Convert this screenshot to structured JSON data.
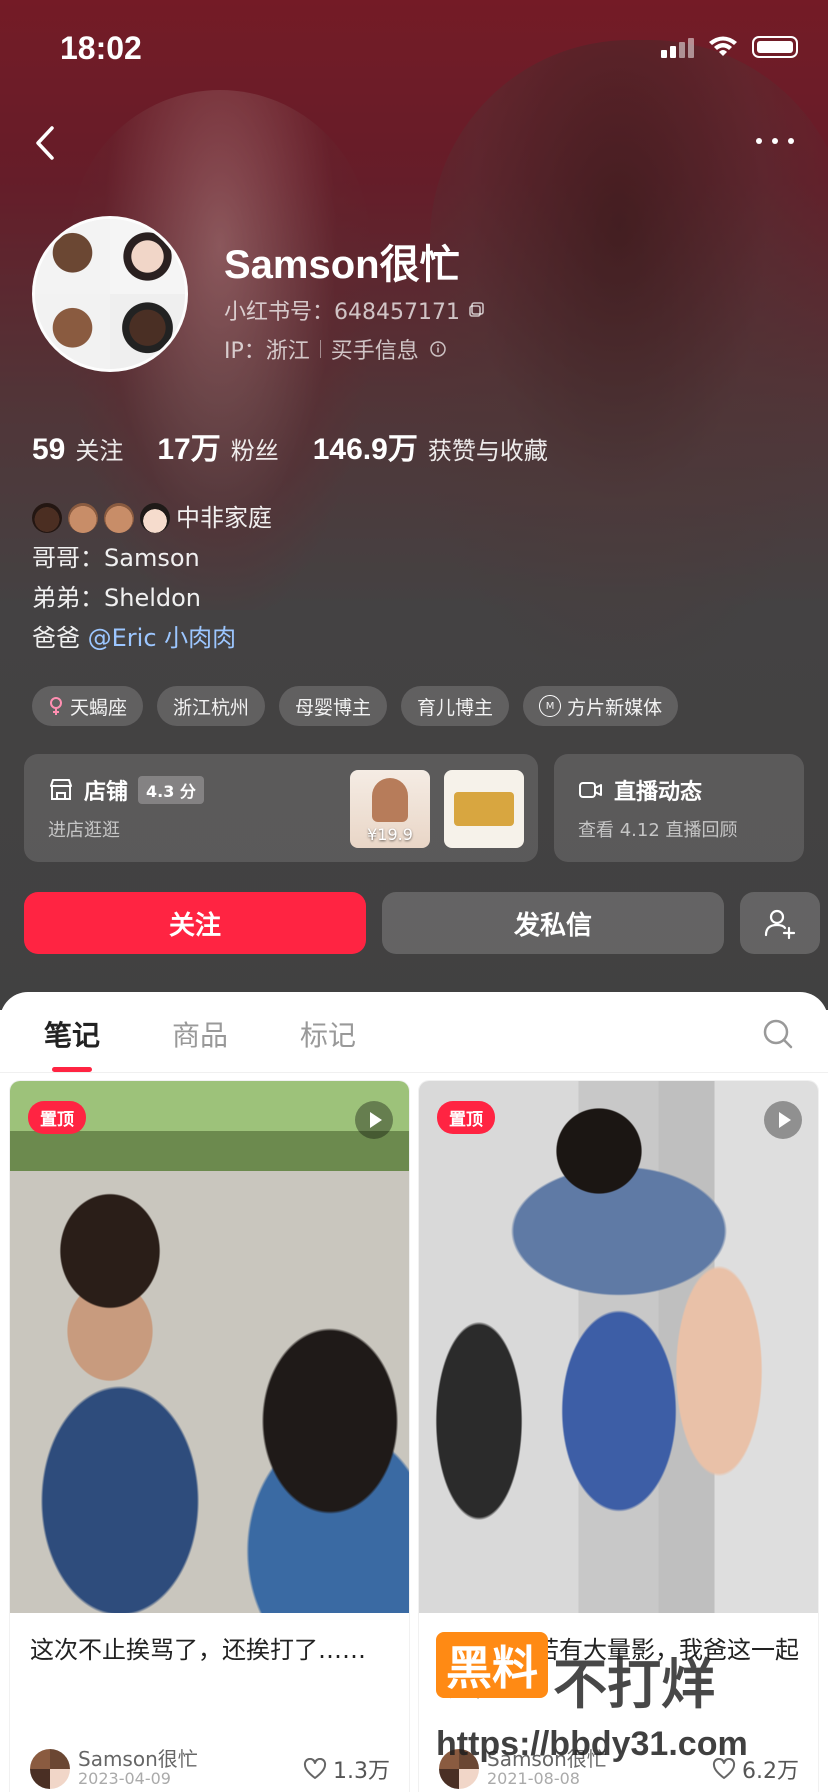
{
  "status": {
    "time": "18:02"
  },
  "profile": {
    "name": "Samson很忙",
    "id_line": "小红书号：648457171",
    "ip_label": "IP：浙江",
    "buyer_info": "买手信息",
    "stats": [
      {
        "num": "59",
        "label": "关注"
      },
      {
        "num": "17万",
        "label": "粉丝"
      },
      {
        "num": "146.9万",
        "label": "获赞与收藏"
      }
    ],
    "bio": {
      "family": "中非家庭",
      "line_brother": "哥哥：Samson",
      "line_younger": "弟弟：Sheldon",
      "line_dad_prefix": "爸爸",
      "line_dad_link": "@Eric 小肉肉"
    },
    "tags": [
      "天蝎座",
      "浙江杭州",
      "母婴博主",
      "育儿博主",
      "方片新媒体"
    ],
    "shop": {
      "title": "店铺",
      "rating": "4.3 分",
      "sub": "进店逛逛",
      "price1": "¥19.9"
    },
    "live": {
      "title": "直播动态",
      "sub": "查看 4.12 直播回顾"
    },
    "buttons": {
      "follow": "关注",
      "message": "发私信"
    }
  },
  "tabs": [
    "笔记",
    "商品",
    "标记"
  ],
  "notes": [
    {
      "badge": "置顶",
      "title": "这次不止挨骂了，还挨打了……",
      "author": "Samson很忙",
      "date": "2023-04-09",
      "likes": "1.3万"
    },
    {
      "badge": "置顶",
      "title": "我哥小技若有大量影，我爸这一起就冲",
      "author": "Samson很忙",
      "date": "2021-08-08",
      "likes": "6.2万"
    }
  ],
  "watermark": {
    "badge": "黑料",
    "text": "不打烊",
    "url": "https://bbdy31.com"
  },
  "colors": {
    "accent": "#ff2442",
    "header_top": "#8e1726"
  }
}
